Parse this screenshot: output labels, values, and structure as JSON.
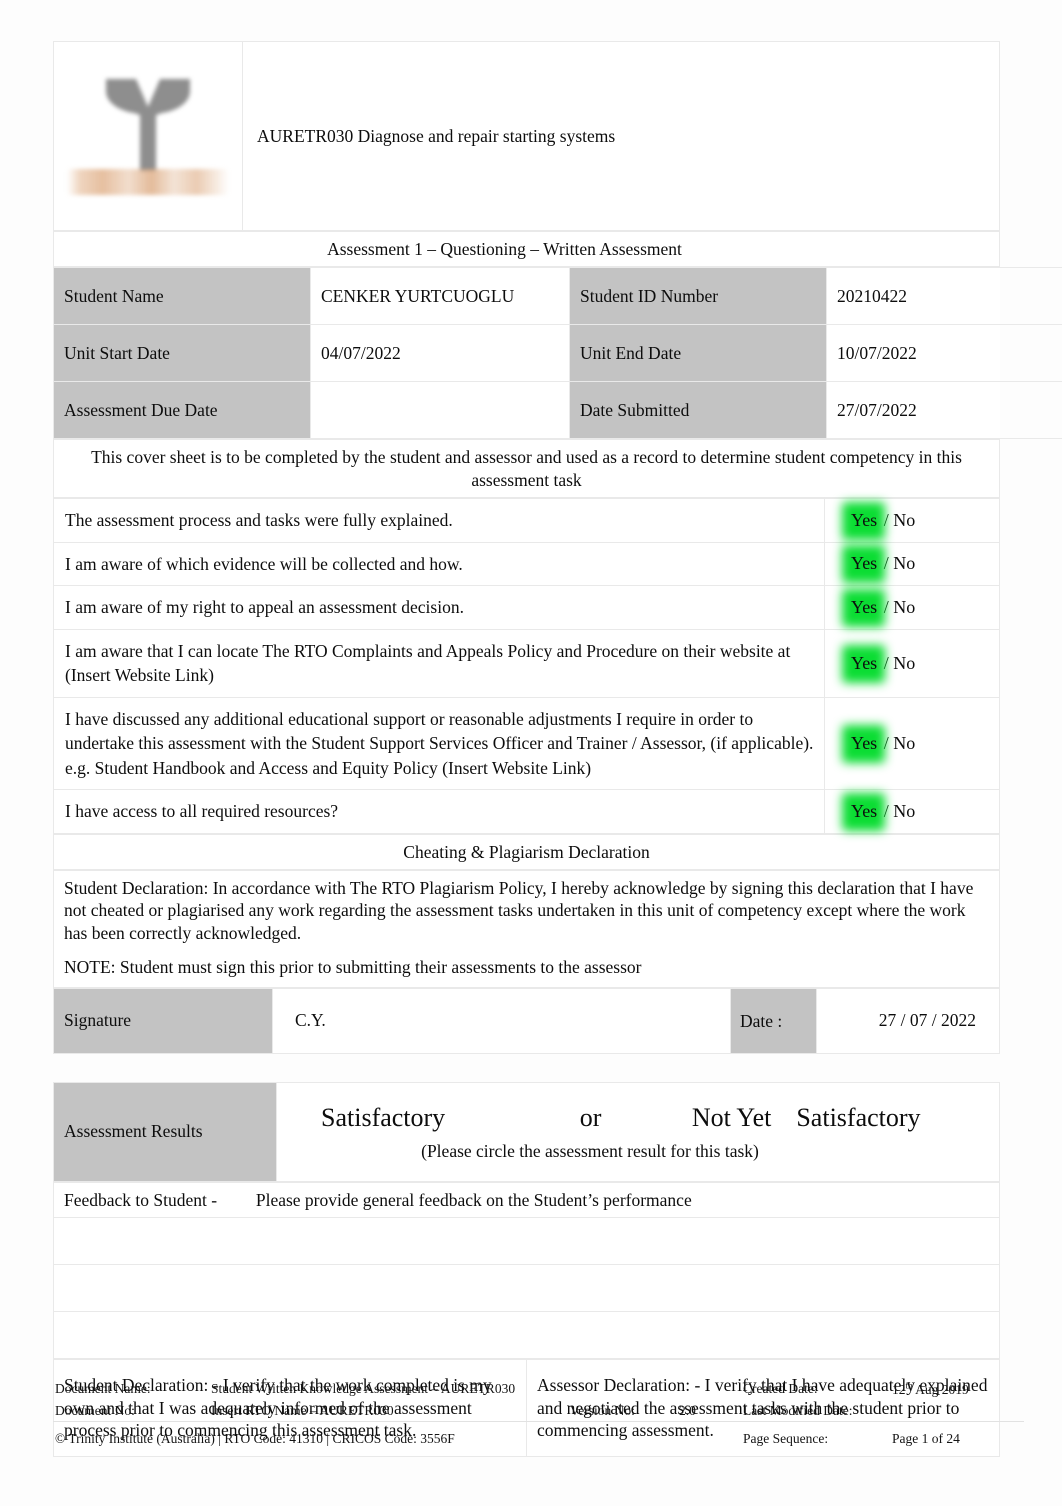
{
  "header": {
    "logo_alt": "trinity-institute-logo",
    "unit_title": "AURETR030 Diagnose and repair starting systems",
    "assessment_title": "Assessment 1 – Questioning – Written Assessment"
  },
  "info": {
    "student_name_label": "Student Name",
    "student_name_value": "CENKER YURTCUOGLU",
    "student_id_label": "Student ID Number",
    "student_id_value": "20210422",
    "unit_start_label": "Unit Start Date",
    "unit_start_value": "04/07/2022",
    "unit_end_label": "Unit End Date",
    "unit_end_value": "10/07/2022",
    "due_date_label": "Assessment Due Date",
    "due_date_value": "",
    "date_submitted_label": "Date Submitted",
    "date_submitted_value": "27/07/2022"
  },
  "cover_note": "This cover sheet is to be completed by the student and assessor and used as a record to determine student competency in this assessment task",
  "questions": [
    {
      "text": "The assessment process and tasks were fully explained.",
      "yes": "Yes",
      "sep": "/",
      "no": "No",
      "selected": "Yes"
    },
    {
      "text": "I am aware of which evidence will be collected and how.",
      "yes": "Yes",
      "sep": "/",
      "no": "No",
      "selected": "Yes"
    },
    {
      "text": "I am aware of my right to appeal an assessment decision.",
      "yes": "Yes",
      "sep": "/",
      "no": "No",
      "selected": "Yes"
    },
    {
      "text": "I am aware that I can locate      The RTO   Complaints and Appeals Policy and Procedure         on their website at   (Insert Website Link)",
      "yes": "Yes",
      "sep": "/",
      "no": "No",
      "selected": "Yes"
    },
    {
      "text": "I have discussed any additional educational support or reasonable adjustments I require in order to undertake this assessment with the Student Support Services Officer and Trainer / Assessor, (if applicable). e.g.    Student Handbook    and  Access and Equity Policy (Insert Website Link)",
      "yes": "Yes",
      "sep": "/",
      "no": "No",
      "selected": "Yes"
    },
    {
      "text": "I have access to all required resources?",
      "yes": "Yes",
      "sep": "/",
      "no": "No",
      "selected": "Yes"
    }
  ],
  "plagiarism": {
    "banner": "Cheating & Plagiarism Declaration",
    "declaration": "Student Declaration:      In accordance with    The RTO   Plagiarism Policy, I hereby acknowledge by signing this declaration that I have not cheated or plagiarised any work regarding the assessment tasks undertaken in this unit of competency except where the work has been correctly acknowledged.",
    "note": "NOTE: Student must sign this prior to submitting their assessments to the assessor"
  },
  "signature": {
    "signature_label": "Signature",
    "signature_value": "C.Y.",
    "date_label": "Date :",
    "date_value": "27 / 07 / 2022"
  },
  "results": {
    "label": "Assessment Results",
    "option_satisfactory": "Satisfactory",
    "option_or": "or",
    "option_not_yet": "Not Yet",
    "option_not_yet_satisfactory": "Satisfactory",
    "instruction": "(Please circle the assessment result for this task)",
    "feedback_label": "Feedback to Student -",
    "feedback_prompt": "Please provide general feedback on the Student’s performance",
    "feedback_value": ""
  },
  "bottom_declarations": {
    "student": "Student Declaration: -      I verify that the work completed is my own and that I was adequately informed of the assessment process prior to commencing this assessment task.",
    "assessor": "Assessor Declaration: -      I verify that I have adequately explained and negotiated the assessment tasks with the student prior to commencing assessment."
  },
  "footer": {
    "document_name_label": "Document Name:",
    "document_name_value": "Student Written Knowledge Assessment – AURETR030",
    "document_no_label": "Document No:",
    "document_no_value": "Insert RTO Name    – AURETR030",
    "version_label": "Version No:",
    "version_value": "2.0",
    "created_date_label": "Created Date:",
    "created_date_value_num": "12",
    "created_date_value_sup": "th",
    "created_date_value_rest": " Aug 2019",
    "last_modified_label": "Last Modified Date:",
    "last_modified_value": "",
    "page_sequence_label": "Page Sequence:",
    "page_sequence_value": "Page   1 of 24",
    "copyright": "© Trinity Institute (Australia) | RTO Code: 41310 | CRICOS Code: 3556F"
  }
}
